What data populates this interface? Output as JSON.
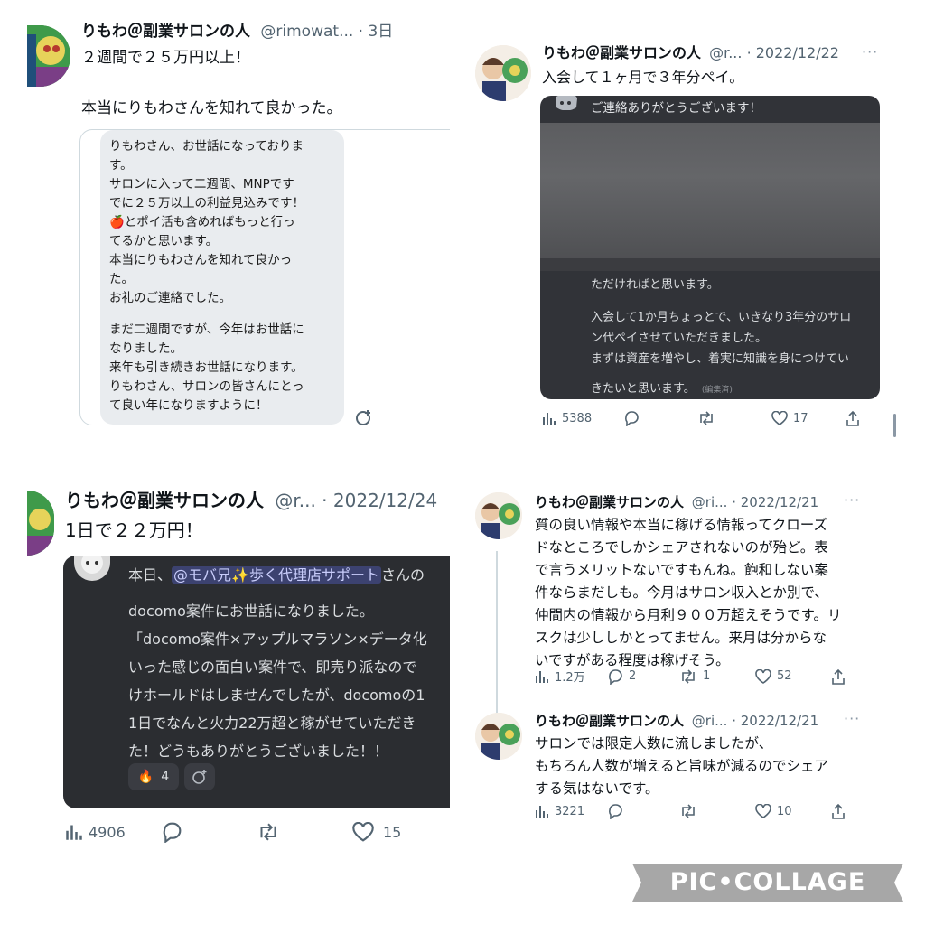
{
  "colors": {
    "text": "#0f1419",
    "muted": "#536471",
    "discord_bg": "#2b2d31",
    "mention_bg": "#3c4270",
    "mention_fg": "#c9cdfb"
  },
  "t1": {
    "name": "りもわ＠副業サロンの人",
    "meta": "@rimowat... · 3日",
    "text1": "２週間で２５万円以上！",
    "text2": "本当にりもわさんを知れて良かった。",
    "bubble": [
      "りもわさん、お世話になっておりま",
      "す。",
      "サロンに入って二週間、MNPです",
      "でに２５万以上の利益見込みです！",
      "🍎とポイ活も含めればもっと行っ",
      "てるかと思います。",
      "本当にりもわさんを知れて良かっ",
      "た。",
      "お礼のご連絡でした。",
      "",
      "まだ二週間ですが、今年はお世話に",
      "なりました。",
      "来年も引き続きお世話になります。",
      "りもわさん、サロンの皆さんにとっ",
      "て良い年になりますように！"
    ]
  },
  "t2": {
    "name": "りもわ＠副業サロンの人",
    "meta": "@r... · 2022/12/22",
    "text": "入会して１ヶ月で３年分ペイ。",
    "card_header": "ご連絡ありがとうございます！",
    "card_lines": [
      "ただければと思います。",
      "",
      "入会して1か月ちょっとで、いきなり3年分のサロ",
      "ン代ペイさせていただきました。",
      "まずは資産を増やし、着実に知識を身につけてい"
    ],
    "card_last": "きたいと思います。",
    "edited": "(編集済)",
    "stats": {
      "views": "5388",
      "replies": "",
      "reposts": "",
      "likes": "17"
    }
  },
  "t3": {
    "name": "りもわ＠副業サロンの人",
    "meta": "@r... · 2022/12/24",
    "text": "1日で２２万円！",
    "msg_prefix": "本日、",
    "mention": "@モバ兄✨歩く代理店サポート",
    "msg_after_mention": "さんの",
    "msg_lines": [
      "docomo案件にお世話になりました。",
      "「docomo案件×アップルマラソン×データ化",
      "いった感じの面白い案件で、即売り派なので",
      "けホールドはしませんでしたが、docomoの1",
      "1日でなんと火力22万超と稼がせていただき",
      "た！どうもありがとうございました！！"
    ],
    "reaction_emoji": "🔥",
    "reaction_count": "4",
    "stats": {
      "views": "4906",
      "replies": "",
      "reposts": "",
      "likes": "15"
    }
  },
  "t4": {
    "name": "りもわ＠副業サロンの人",
    "meta": "@ri... · 2022/12/21",
    "lines": [
      "質の良い情報や本当に稼げる情報ってクローズ",
      "ドなところでしかシェアされないのが殆ど。表",
      "で言うメリットないですもんね。飽和しない案",
      "件ならまだしも。今月はサロン収入とか別で、",
      "仲間内の情報から月利９００万超えそうです。リ",
      "スクは少ししかとってません。来月は分からな",
      "いですがある程度は稼げそう。"
    ],
    "stats": {
      "views": "1.2万",
      "replies": "2",
      "reposts": "1",
      "likes": "52"
    }
  },
  "t5": {
    "name": "りもわ＠副業サロンの人",
    "meta": "@ri... · 2022/12/21",
    "lines": [
      "サロンでは限定人数に流しましたが、",
      "もちろん人数が増えると旨味が減るのでシェア",
      "する気はないです。"
    ],
    "stats": {
      "views": "3221",
      "replies": "",
      "reposts": "",
      "likes": "10"
    }
  },
  "watermark": "PIC•COLLAGE"
}
